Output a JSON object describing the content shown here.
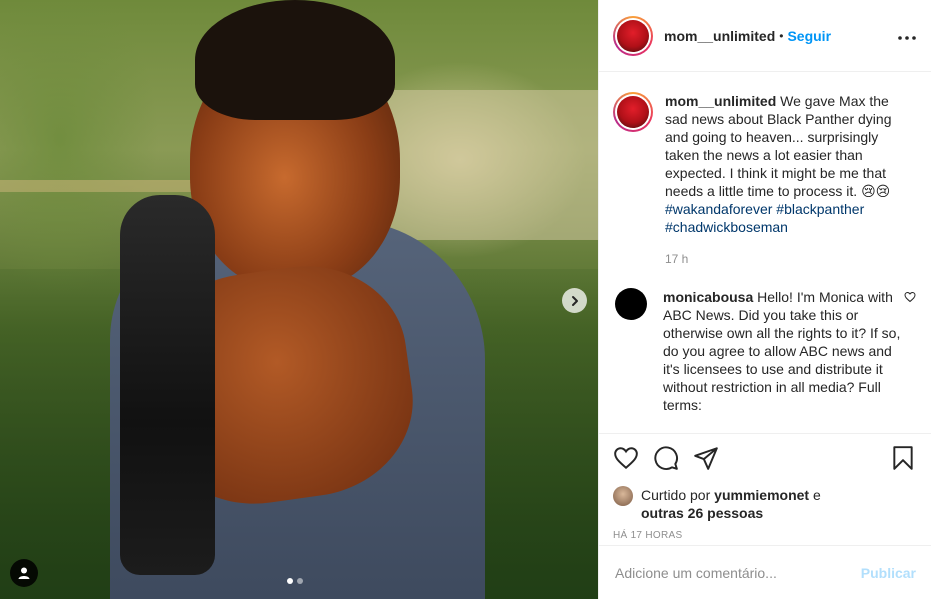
{
  "post": {
    "username": "mom__unlimited",
    "separator": "•",
    "follow_label": "Seguir",
    "more_label": "•••",
    "caption": "We gave Max the sad news about Black Panther dying and going to heaven... surprisingly taken the news a lot easier than expected. I think it might be me that needs a little time to process it. 😢😢",
    "hashtags": [
      "#wakandaforever",
      "#blackpanther",
      "#chadwickboseman"
    ],
    "caption_time": "17 h"
  },
  "comment": {
    "username": "monicabousa",
    "text": "Hello! I'm Monica with ABC News. Did you take this or otherwise own all the rights to it? If so, do you agree to allow ABC news and it's licensees to use and distribute it without restriction in all media? Full terms:"
  },
  "likes": {
    "prefix": "Curtido por",
    "user": "yummiemonet",
    "connector": "e",
    "others": "outras 26 pessoas"
  },
  "timestamp": "HÁ 17 HORAS",
  "add_comment": {
    "placeholder": "Adicione um comentário...",
    "post_label": "Publicar"
  },
  "carousel": {
    "slides": 2,
    "current": 1
  },
  "colors": {
    "link": "#0095f6",
    "hashtag": "#00376b",
    "muted": "#8e8e8e",
    "publish_disabled": "#b2dffc"
  },
  "icons": [
    "chevron-right-icon",
    "person-tag-icon",
    "more-icon",
    "heart-icon",
    "comment-icon",
    "share-icon",
    "bookmark-icon"
  ]
}
